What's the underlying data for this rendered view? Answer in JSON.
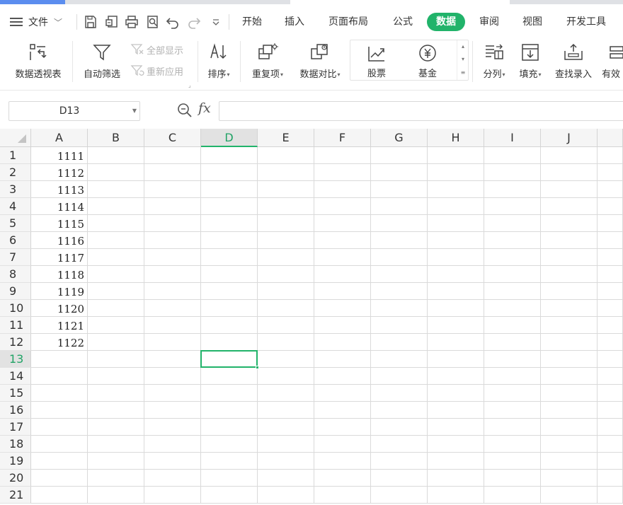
{
  "menubar": {
    "file_label": "文件",
    "tabs": [
      {
        "label": "开始",
        "active": false
      },
      {
        "label": "插入",
        "active": false
      },
      {
        "label": "页面布局",
        "active": false
      },
      {
        "label": "公式",
        "active": false
      },
      {
        "label": "数据",
        "active": true
      },
      {
        "label": "审阅",
        "active": false
      },
      {
        "label": "视图",
        "active": false
      },
      {
        "label": "开发工具",
        "active": false
      }
    ],
    "quick_access": [
      "save-icon",
      "export-pdf-icon",
      "print-icon",
      "print-preview-icon",
      "undo-icon",
      "redo-icon",
      "customize-chevron-icon"
    ]
  },
  "ribbon": {
    "pivot_label": "数据透视表",
    "autofilter_label": "自动筛选",
    "show_all_label": "全部显示",
    "reapply_label": "重新应用",
    "sort_label": "排序",
    "duplicates_label": "重复项",
    "compare_label": "数据对比",
    "stock_label": "股票",
    "fund_label": "基金",
    "split_label": "分列",
    "fill_label": "填充",
    "lookup_label": "查找录入",
    "validity_label": "有效"
  },
  "formula_bar": {
    "name_box": "D13",
    "fx_label": "fx",
    "formula": ""
  },
  "sheet": {
    "columns": [
      "A",
      "B",
      "C",
      "D",
      "E",
      "F",
      "G",
      "H",
      "I",
      "J"
    ],
    "rows": [
      "1",
      "2",
      "3",
      "4",
      "5",
      "6",
      "7",
      "8",
      "9",
      "10",
      "11",
      "12",
      "13",
      "14",
      "15",
      "16",
      "17",
      "18",
      "19",
      "20",
      "21"
    ],
    "column_a_values": [
      "1111",
      "1112",
      "1113",
      "1114",
      "1115",
      "1116",
      "1117",
      "1118",
      "1119",
      "1120",
      "1121",
      "1122"
    ],
    "selected_cell": "D13",
    "selected_column": "D",
    "selected_row": "13"
  },
  "colors": {
    "accent": "#21b36a",
    "header_bg": "#f5f5f5",
    "gridline": "#dadada"
  }
}
